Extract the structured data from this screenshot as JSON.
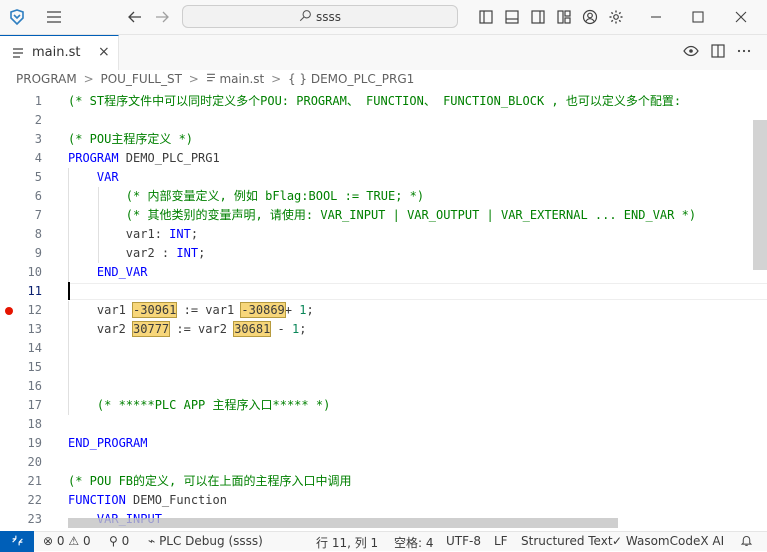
{
  "titlebar": {
    "search_text": "ssss",
    "search_icon": "search-icon"
  },
  "tab": {
    "label": "main.st",
    "close": "×"
  },
  "breadcrumb": {
    "items": [
      "PROGRAM",
      "POU_FULL_ST",
      "main.st",
      "{ } DEMO_PLC_PRG1"
    ],
    "separator": ">"
  },
  "editor": {
    "lines": [
      {
        "n": "1",
        "parts": [
          {
            "c": "cm",
            "t": "(* ST程序文件中可以同时定义多个POU: PROGRAM、 FUNCTION、 FUNCTION_BLOCK , 也可以定义多个配置:"
          }
        ]
      },
      {
        "n": "2",
        "parts": []
      },
      {
        "n": "3",
        "parts": [
          {
            "c": "cm",
            "t": "(* POU主程序定义 *)"
          }
        ]
      },
      {
        "n": "4",
        "parts": [
          {
            "c": "kw",
            "t": "PROGRAM"
          },
          {
            "c": "tx",
            "t": " DEMO_PLC_PRG1"
          }
        ]
      },
      {
        "n": "5",
        "parts": [
          {
            "c": "tx",
            "t": "    "
          },
          {
            "c": "kw",
            "t": "VAR"
          }
        ]
      },
      {
        "n": "6",
        "parts": [
          {
            "c": "tx",
            "t": "        "
          },
          {
            "c": "cm",
            "t": "(* 内部变量定义, 例如 bFlag:BOOL := TRUE; *)"
          }
        ]
      },
      {
        "n": "7",
        "parts": [
          {
            "c": "tx",
            "t": "        "
          },
          {
            "c": "cm",
            "t": "(* 其他类别的变量声明, 请使用: VAR_INPUT | VAR_OUTPUT | VAR_EXTERNAL ... END_VAR *)"
          }
        ]
      },
      {
        "n": "8",
        "parts": [
          {
            "c": "tx",
            "t": "        var1: "
          },
          {
            "c": "ty",
            "t": "INT"
          },
          {
            "c": "tx",
            "t": ";"
          }
        ]
      },
      {
        "n": "9",
        "parts": [
          {
            "c": "tx",
            "t": "        var2 : "
          },
          {
            "c": "ty",
            "t": "INT"
          },
          {
            "c": "tx",
            "t": ";"
          }
        ]
      },
      {
        "n": "10",
        "parts": [
          {
            "c": "tx",
            "t": "    "
          },
          {
            "c": "kw",
            "t": "END_VAR"
          }
        ]
      },
      {
        "n": "11",
        "parts": []
      },
      {
        "n": "12",
        "parts": [
          {
            "c": "tx",
            "t": "    var1 "
          },
          {
            "c": "val",
            "t": "-30961"
          },
          {
            "c": "tx",
            "t": " := var1 "
          },
          {
            "c": "val",
            "t": "-30869"
          },
          {
            "c": "tx",
            "t": "+ "
          },
          {
            "c": "num",
            "t": "1"
          },
          {
            "c": "tx",
            "t": ";"
          }
        ]
      },
      {
        "n": "13",
        "parts": [
          {
            "c": "tx",
            "t": "    var2 "
          },
          {
            "c": "val",
            "t": "30777"
          },
          {
            "c": "tx",
            "t": " := var2 "
          },
          {
            "c": "val",
            "t": "30681"
          },
          {
            "c": "tx",
            "t": " - "
          },
          {
            "c": "num",
            "t": "1"
          },
          {
            "c": "tx",
            "t": ";"
          }
        ]
      },
      {
        "n": "14",
        "parts": []
      },
      {
        "n": "15",
        "parts": []
      },
      {
        "n": "16",
        "parts": []
      },
      {
        "n": "17",
        "parts": [
          {
            "c": "tx",
            "t": "    "
          },
          {
            "c": "cm",
            "t": "(* *****PLC APP 主程序入口***** *)"
          }
        ]
      },
      {
        "n": "18",
        "parts": []
      },
      {
        "n": "19",
        "parts": [
          {
            "c": "kw",
            "t": "END_PROGRAM"
          }
        ]
      },
      {
        "n": "20",
        "parts": []
      },
      {
        "n": "21",
        "parts": [
          {
            "c": "cm",
            "t": "(* POU FB的定义, 可以在上面的主程序入口中调用"
          }
        ]
      },
      {
        "n": "22",
        "parts": [
          {
            "c": "kw",
            "t": "FUNCTION"
          },
          {
            "c": "tx",
            "t": " DEMO_Function"
          }
        ]
      },
      {
        "n": "23",
        "parts": [
          {
            "c": "tx",
            "t": "    "
          },
          {
            "c": "kw",
            "t": "VAR_INPUT"
          }
        ]
      }
    ],
    "breakpoint_line": "12",
    "current_line": "11"
  },
  "statusbar": {
    "remote_icon": "remote-icon",
    "errors": "0",
    "warnings": "0",
    "ports": "0",
    "debug": "PLC Debug (ssss)",
    "position": "行 11, 列 1",
    "spaces": "空格: 4",
    "encoding": "UTF-8",
    "eol": "LF",
    "language": "Structured Text",
    "extension": "WasomCodeX AI"
  },
  "colors": {
    "accent": "#005fb8",
    "comment": "#008000",
    "keyword": "#0000ff",
    "value_highlight": "#f7d67a",
    "breakpoint": "#e51400"
  }
}
